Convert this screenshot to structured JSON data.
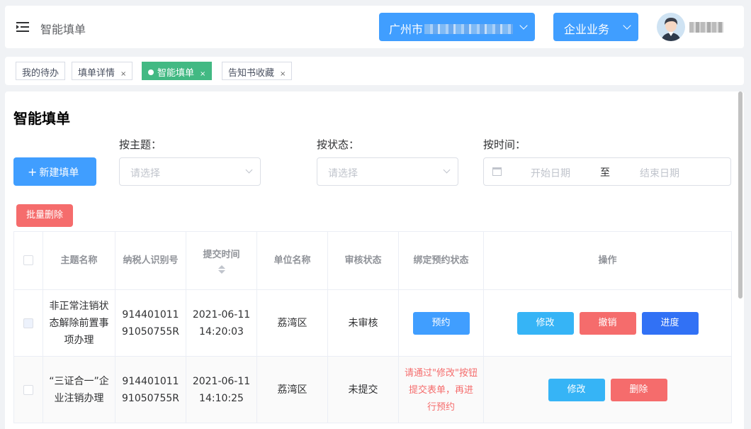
{
  "header": {
    "title": "智能填单",
    "city_select": {
      "value": "广州市"
    },
    "business_select": {
      "value": "企业业务"
    }
  },
  "tabs": [
    {
      "label": "我的待办",
      "closable": false,
      "active": false
    },
    {
      "label": "填单详情",
      "closable": true,
      "active": false
    },
    {
      "label": "智能填单",
      "closable": true,
      "active": true
    },
    {
      "label": "告知书收藏",
      "closable": true,
      "active": false
    }
  ],
  "tab_close_glyph": "×",
  "page": {
    "title": "智能填单",
    "new_button": "新建填单",
    "batch_delete": "批量删除",
    "filters": {
      "topic": {
        "label": "按主题：",
        "placeholder": "请选择"
      },
      "status": {
        "label": "按状态：",
        "placeholder": "请选择"
      },
      "time": {
        "label": "按时间：",
        "start_placeholder": "开始日期",
        "separator": "至",
        "end_placeholder": "结束日期"
      }
    }
  },
  "table": {
    "columns": {
      "topic": "主题名称",
      "taxpayer_id": "纳税人识别号",
      "submit_time": "提交时间",
      "unit": "单位名称",
      "review_status": "审核状态",
      "booking_status": "绑定预约状态",
      "actions": "操作"
    },
    "rows": [
      {
        "topic": "非正常注销状态解除前置事项办理",
        "taxpayer_id": "91440101191050755R",
        "submit_date": "2021-06-11",
        "submit_time": "14:20:03",
        "unit": "荔湾区",
        "review_status": "未审核",
        "booking": "预约",
        "actions": {
          "edit": "修改",
          "revoke": "撤销",
          "progress": "进度"
        }
      },
      {
        "topic": "“三证合一”企业注销办理",
        "taxpayer_id": "91440101191050755R",
        "submit_date": "2021-06-11",
        "submit_time": "14:10:25",
        "unit": "荔湾区",
        "review_status": "未提交",
        "booking_hint": "请通过\"修改\"按钮提交表单，再进行预约",
        "actions": {
          "edit": "修改",
          "delete": "删除"
        }
      }
    ]
  },
  "colors": {
    "primary": "#409eff",
    "success_tab": "#42b983",
    "danger": "#f56c6c",
    "progress": "#3171f5"
  }
}
